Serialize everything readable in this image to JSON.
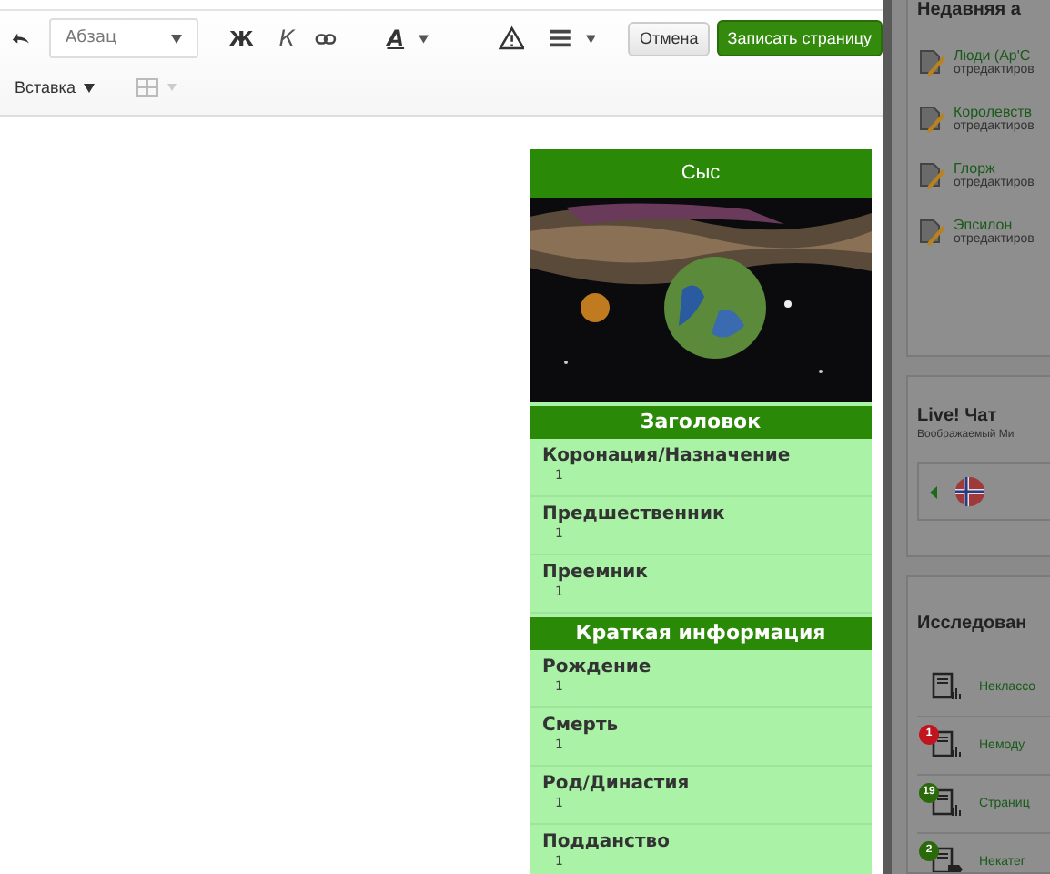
{
  "toolbar": {
    "format_dropdown": "Абзац",
    "bold": "Ж",
    "italic": "К",
    "text_color": "A",
    "cancel_button": "Отмена",
    "save_button": "Записать страницу",
    "insert_menu": "Вставка",
    "table_disabled": true
  },
  "infobox": {
    "title": "Сыс",
    "sections": [
      {
        "header": "Заголовок",
        "rows": [
          {
            "label": "Коронация/Назначение",
            "value": "1"
          },
          {
            "label": "Предшественник",
            "value": "1"
          },
          {
            "label": "Преемник",
            "value": "1"
          }
        ]
      },
      {
        "header": "Краткая информация",
        "rows": [
          {
            "label": "Рождение",
            "value": "1"
          },
          {
            "label": "Смерть",
            "value": "1"
          },
          {
            "label": "Род/Династия",
            "value": "1"
          },
          {
            "label": "Подданство",
            "value": "1"
          }
        ]
      }
    ]
  },
  "sidebar": {
    "recent": {
      "title": "Недавняя а",
      "items": [
        {
          "title": "Люди (Ар'С",
          "meta": "отредактиров"
        },
        {
          "title": "Королевств",
          "meta": "отредактиров"
        },
        {
          "title": "Глорж",
          "meta": "отредактиров"
        },
        {
          "title": "Эпсилон",
          "meta": "отредактиров"
        }
      ]
    },
    "chat": {
      "title": "Live! Чат",
      "subtitle": "Воображаемый Ми"
    },
    "insights": {
      "title": "Исследован",
      "items": [
        {
          "label": "Неклассо",
          "kind": "chart"
        },
        {
          "label": "Немоду",
          "badge": "1",
          "color": "#c0141e",
          "kind": "chart"
        },
        {
          "label": "Страниц",
          "badge": "19",
          "color": "#2a6a0a",
          "kind": "chart"
        },
        {
          "label": "Некатег",
          "badge": "2",
          "color": "#2a6a0a",
          "kind": "tag"
        }
      ]
    }
  }
}
